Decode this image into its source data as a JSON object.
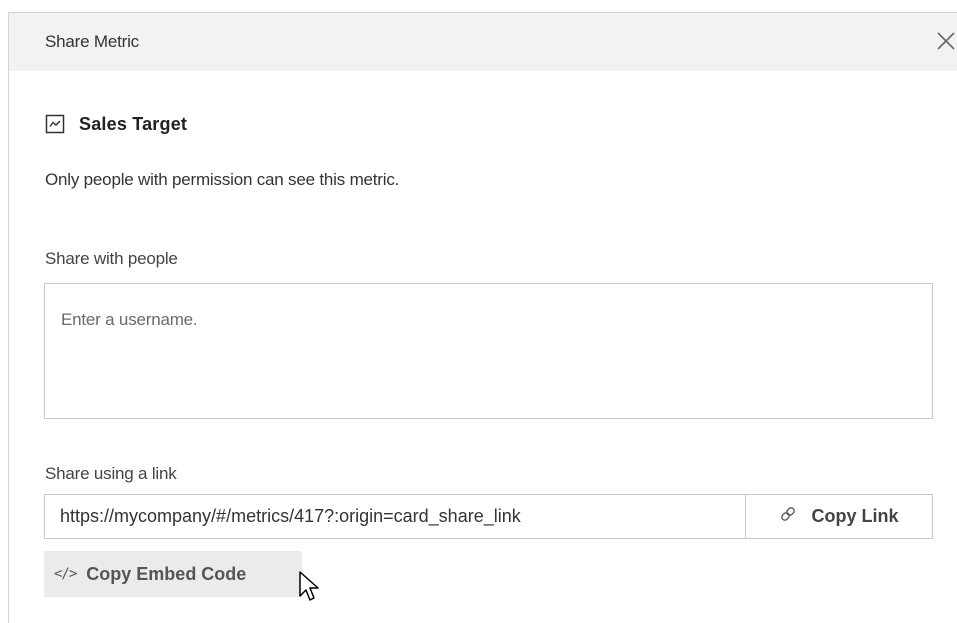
{
  "dialog": {
    "title": "Share Metric",
    "close_icon": "close-icon"
  },
  "metric": {
    "icon": "line-chart-icon",
    "name": "Sales Target",
    "permission_text": "Only people with permission can see this metric."
  },
  "share_people": {
    "label": "Share with people",
    "placeholder": "Enter a username.",
    "value": ""
  },
  "share_link": {
    "label": "Share using a link",
    "url": "https://mycompany/#/metrics/417?:origin=card_share_link",
    "copy_icon": "link-icon",
    "copy_label": "Copy Link"
  },
  "embed": {
    "icon": "code-icon",
    "icon_glyph": "</>",
    "label": "Copy Embed Code"
  },
  "colors": {
    "header_bg": "#f2f2f2",
    "border": "#c8c8c8",
    "embed_bg": "#ebebeb",
    "text": "#333333"
  }
}
